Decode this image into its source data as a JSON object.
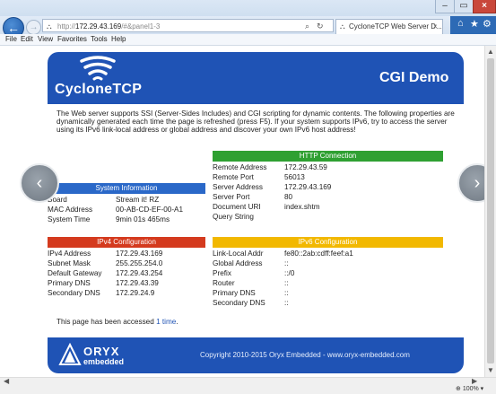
{
  "browser": {
    "url_prefix": "http://",
    "url_host": "172.29.43.169",
    "url_hash": "/#&panel1-3",
    "tab_label": "CycloneTCP Web Server D...",
    "tab_close": "×",
    "zoom": "100%",
    "menu": [
      "File",
      "Edit",
      "View",
      "Favorites",
      "Tools",
      "Help"
    ]
  },
  "header": {
    "logo_text": "CycloneTCP",
    "title": "CGI Demo"
  },
  "intro": "The Web server supports SSI (Server-Sides Includes) and CGI scripting for dynamic contents. The following properties are dynamically generated each time the page is refreshed (press F5). If your system supports IPv6, try to access the server using its IPv6 link-local address or global address and discover your own IPv6 host address!",
  "http": {
    "title": "HTTP Connection",
    "rows": [
      {
        "k": "Remote Address",
        "v": "172.29.43.59"
      },
      {
        "k": "Remote Port",
        "v": "56013"
      },
      {
        "k": "Server Address",
        "v": "172.29.43.169"
      },
      {
        "k": "Server Port",
        "v": "80"
      },
      {
        "k": "Document URI",
        "v": "index.shtm"
      },
      {
        "k": "Query String",
        "v": ""
      }
    ]
  },
  "system": {
    "title": "System Information",
    "rows": [
      {
        "k": "Board",
        "v": "Stream it! RZ"
      },
      {
        "k": "MAC Address",
        "v": "00-AB-CD-EF-00-A1"
      },
      {
        "k": "System Time",
        "v": "9min 01s 465ms"
      }
    ]
  },
  "ipv4": {
    "title": "IPv4 Configuration",
    "rows": [
      {
        "k": "IPv4 Address",
        "v": "172.29.43.169"
      },
      {
        "k": "Subnet Mask",
        "v": "255.255.254.0"
      },
      {
        "k": "Default Gateway",
        "v": "172.29.43.254"
      },
      {
        "k": "Primary DNS",
        "v": "172.29.43.39"
      },
      {
        "k": "Secondary DNS",
        "v": "172.29.24.9"
      }
    ]
  },
  "ipv6": {
    "title": "IPv6 Configuration",
    "rows": [
      {
        "k": "Link-Local Addr",
        "v": "fe80::2ab:cdff:feef:a1"
      },
      {
        "k": "Global Address",
        "v": "::"
      },
      {
        "k": "Prefix",
        "v": "::/0"
      },
      {
        "k": "Router",
        "v": "::"
      },
      {
        "k": "Primary DNS",
        "v": "::"
      },
      {
        "k": "Secondary DNS",
        "v": "::"
      }
    ]
  },
  "access": {
    "before": "This page has been accessed ",
    "link": "1 time",
    "after": "."
  },
  "footer": {
    "brand": "ORYX",
    "brand_sub": "embedded",
    "copyright": "Copyright 2010-2015 Oryx Embedded - www.oryx-embedded.com"
  },
  "colors": {
    "brand_blue": "#1f53b5",
    "http_green": "#2fa032",
    "system_blue": "#2a68c8",
    "ipv4_red": "#d43a1e",
    "ipv6_yellow": "#f2b800"
  }
}
